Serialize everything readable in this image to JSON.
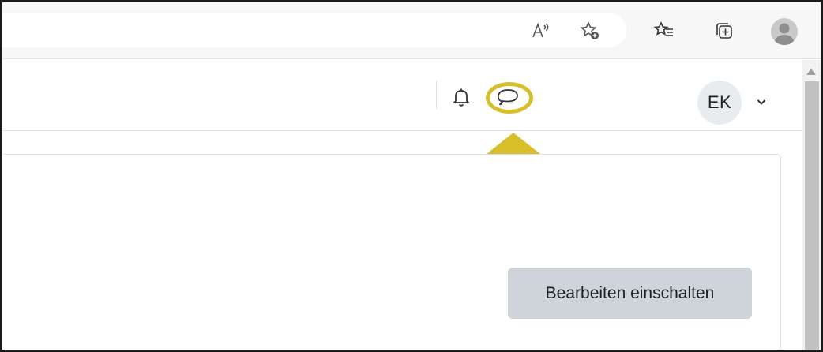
{
  "browser": {
    "toolbar_icons": [
      "read-aloud-icon",
      "add-favorite-icon",
      "favorites-icon",
      "collections-icon",
      "profile-icon"
    ]
  },
  "header": {
    "notification_icon": "bell-icon",
    "messages_icon": "chat-bubble-icon",
    "user_initials": "EK",
    "user_menu_icon": "chevron-down-icon"
  },
  "annotation": {
    "highlight_color": "#d6bf2a",
    "arrow_color": "#d6bf2a"
  },
  "content": {
    "edit_mode_button": "Bearbeiten einschalten"
  },
  "colors": {
    "button_bg": "#ced4da",
    "avatar_bg": "#e9ecef",
    "text": "#1d2125"
  }
}
